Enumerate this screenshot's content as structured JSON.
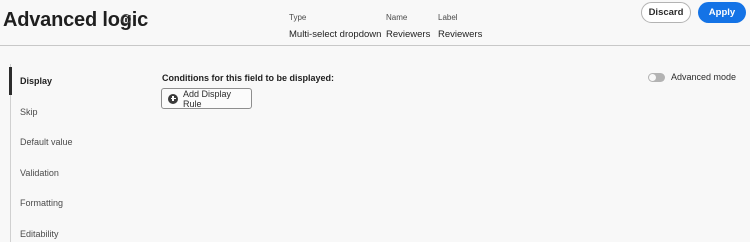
{
  "header": {
    "title": "Advanced logic",
    "meta": [
      {
        "key": "Type",
        "value": "Multi-select dropdown"
      },
      {
        "key": "Name",
        "value": "Reviewers"
      },
      {
        "key": "Label",
        "value": "Reviewers"
      }
    ],
    "discard_label": "Discard",
    "apply_label": "Apply"
  },
  "sidebar": {
    "items": [
      {
        "label": "Display",
        "active": true
      },
      {
        "label": "Skip"
      },
      {
        "label": "Default value"
      },
      {
        "label": "Validation"
      },
      {
        "label": "Formatting"
      },
      {
        "label": "Editability"
      }
    ]
  },
  "main": {
    "conditions_label": "Conditions for this field to be displayed:",
    "add_rule_label": "Add Display Rule",
    "advanced_mode_label": "Advanced mode",
    "advanced_mode_on": false
  },
  "colors": {
    "accent": "#1473e6",
    "background": "#f8f8f8"
  }
}
